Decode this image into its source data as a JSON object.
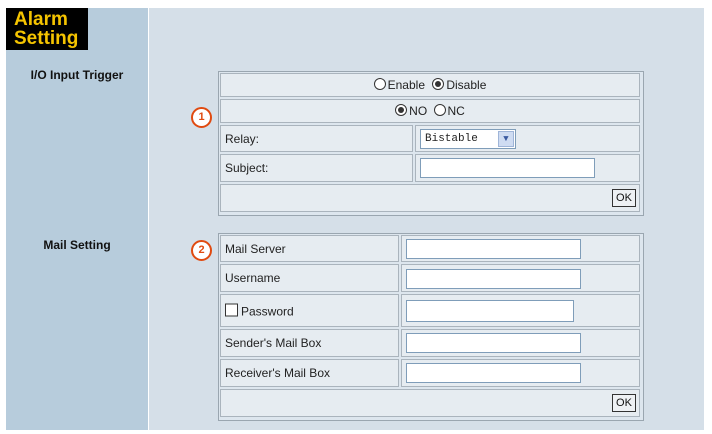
{
  "sidebar": {
    "title_line1": "Alarm",
    "title_line2": "Setting",
    "io_label": "I/O Input Trigger",
    "mail_label": "Mail Setting"
  },
  "callouts": [
    "1",
    "2"
  ],
  "io": {
    "enable_label": "Enable",
    "disable_label": "Disable",
    "selected": "Disable",
    "no_label": "NO",
    "nc_label": "NC",
    "selected_contact": "NO",
    "relay_label": "Relay:",
    "relay_value": "Bistable",
    "subject_label": "Subject:",
    "subject_value": "",
    "ok_label": "OK"
  },
  "mail": {
    "server_label": "Mail Server",
    "server_value": "",
    "username_label": "Username",
    "username_value": "",
    "password_label": "Password",
    "password_checked": false,
    "password_value": "",
    "sender_label": "Sender's Mail Box",
    "sender_value": "",
    "receiver_label": "Receiver's Mail Box",
    "receiver_value": "",
    "ok_label": "OK"
  },
  "colors": {
    "title_bg": "#000000",
    "title_fg": "#f5c400",
    "sidebar_bg": "#b7ccdc",
    "callout": "#e04a10"
  }
}
